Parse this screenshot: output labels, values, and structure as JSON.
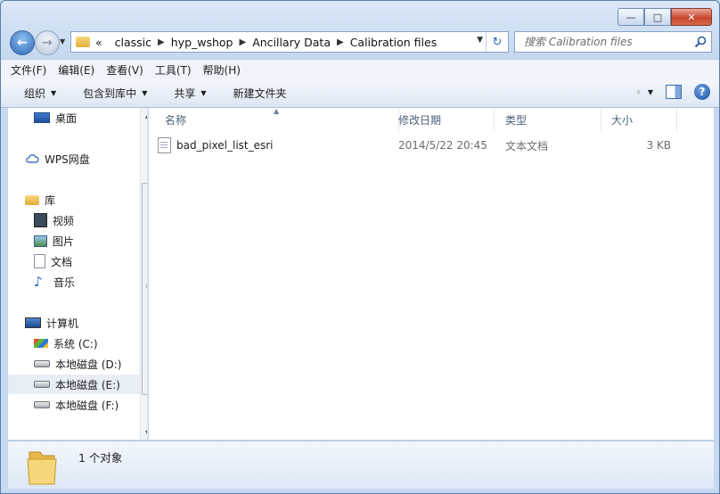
{
  "window": {
    "caption_buttons": {
      "minimize": "—",
      "maximize": "□",
      "close": "✕"
    }
  },
  "address": {
    "overflow": "«",
    "crumbs": [
      "classic",
      "hyp_wshop",
      "Ancillary Data",
      "Calibration files"
    ],
    "separator": "▶"
  },
  "search": {
    "placeholder": "搜索 Calibration files"
  },
  "menubar": [
    "文件(F)",
    "编辑(E)",
    "查看(V)",
    "工具(T)",
    "帮助(H)"
  ],
  "toolbar": {
    "organize": "组织",
    "include": "包含到库中",
    "share": "共享",
    "new_folder": "新建文件夹",
    "help": "?"
  },
  "nav": {
    "desktop": "桌面",
    "wps": "WPS网盘",
    "library": "库",
    "video": "视频",
    "pictures": "图片",
    "documents": "文档",
    "music": "音乐",
    "computer": "计算机",
    "drive_c": "系统 (C:)",
    "drive_d": "本地磁盘 (D:)",
    "drive_e": "本地磁盘 (E:)",
    "drive_f": "本地磁盘 (F:)"
  },
  "columns": {
    "name": "名称",
    "modified": "修改日期",
    "type": "类型",
    "size": "大小"
  },
  "files": [
    {
      "name": "bad_pixel_list_esri",
      "modified": "2014/5/22 20:45",
      "type": "文本文档",
      "size": "3 KB"
    }
  ],
  "status": {
    "count": "1 个对象"
  },
  "colors": {
    "window_frame": "#c6d9f0",
    "selection": "#e8eef6",
    "header_text": "#4c607a"
  }
}
